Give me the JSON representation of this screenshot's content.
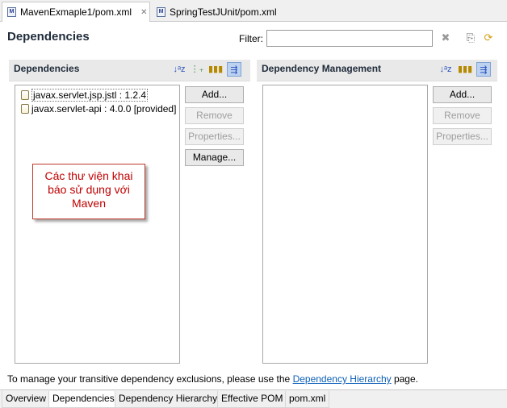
{
  "editor_tabs": [
    {
      "label": "MavenExmaple1/pom.xml",
      "icon": "maven-xml-icon",
      "active": true
    },
    {
      "label": "SpringTestJUnit/pom.xml",
      "icon": "maven-xml-icon",
      "active": false
    }
  ],
  "header": {
    "title": "Dependencies",
    "filter_label": "Filter:",
    "filter_value": "",
    "icons": [
      "clear-filter-icon",
      "show-advanced-icon",
      "refresh-icon"
    ]
  },
  "dependencies": {
    "title": "Dependencies",
    "toolbar_icons": [
      "sort-az-icon",
      "hierarchy-icon",
      "columns-icon",
      "show-inherited-icon"
    ],
    "items": [
      {
        "label": "javax.servlet.jsp.jstl : 1.2.4",
        "selected": true
      },
      {
        "label": "javax.servlet-api : 4.0.0 [provided]",
        "selected": false
      }
    ],
    "buttons": {
      "add": "Add...",
      "remove": "Remove",
      "properties": "Properties...",
      "manage": "Manage..."
    }
  },
  "dependency_management": {
    "title": "Dependency Management",
    "toolbar_icons": [
      "sort-az-icon",
      "columns-icon",
      "show-inherited-icon"
    ],
    "items": [],
    "buttons": {
      "add": "Add...",
      "remove": "Remove",
      "properties": "Properties..."
    }
  },
  "annotation": {
    "line1": "Các thư viện khai",
    "line2": "báo sử dụng với",
    "line3": "Maven"
  },
  "footer": {
    "message_prefix": "To manage your transitive dependency exclusions, please use the ",
    "link": "Dependency Hierarchy",
    "message_suffix": " page."
  },
  "page_tabs": [
    {
      "label": "Overview",
      "active": false
    },
    {
      "label": "Dependencies",
      "active": true
    },
    {
      "label": "Dependency Hierarchy",
      "active": false
    },
    {
      "label": "Effective POM",
      "active": false
    },
    {
      "label": "pom.xml",
      "active": false
    }
  ],
  "colors": {
    "annotation_text": "#c00000",
    "annotation_border": "#c0392b",
    "link": "#0b5fb8"
  }
}
